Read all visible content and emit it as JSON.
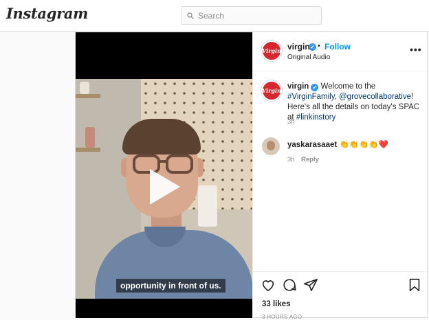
{
  "app": {
    "logo": "Instagram"
  },
  "search": {
    "placeholder": "Search"
  },
  "video": {
    "caption": "opportunity in front of us."
  },
  "post_header": {
    "username": "virgin",
    "separator": "•",
    "follow_label": "Follow",
    "audio": "Original Audio",
    "more_label": "•••"
  },
  "post_caption": {
    "username": "virgin",
    "text_1": " Welcome to the ",
    "tag_1": "#VirginFamily",
    "text_2": ", ",
    "mention": "@grovecollaborative",
    "text_3": "! Here's all the details on today's SPAC at ",
    "tag_2": "#linkinstory",
    "time": "3h"
  },
  "comment": {
    "username": "yaskarasaaet",
    "text": " 👏👏👏👏❤️",
    "time": "3h",
    "reply_label": "Reply"
  },
  "stats": {
    "likes": "33 likes",
    "posted": "3 HOURS AGO"
  },
  "avatar_badge": "Virgin",
  "colors": {
    "accent": "#0095f6",
    "brand": "#d7262e",
    "verified": "#3897f0"
  },
  "icons": [
    "search-icon",
    "verified-icon",
    "more-icon",
    "heart-icon",
    "comment-icon",
    "share-icon",
    "bookmark-icon",
    "play-icon"
  ]
}
